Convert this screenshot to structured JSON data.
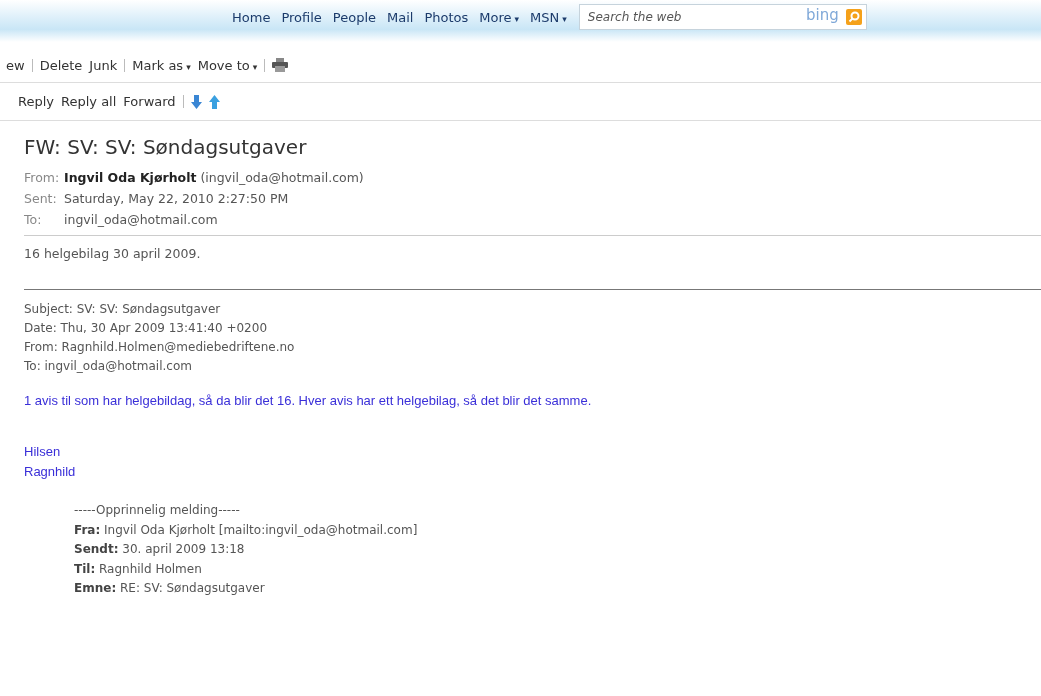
{
  "nav": {
    "links": [
      {
        "label": "Home"
      },
      {
        "label": "Profile"
      },
      {
        "label": "People"
      },
      {
        "label": "Mail"
      },
      {
        "label": "Photos"
      },
      {
        "label": "More",
        "caret": "▾"
      },
      {
        "label": "MSN",
        "caret": "▾"
      }
    ],
    "search": {
      "placeholder": "Search the web",
      "logo": "bing"
    }
  },
  "toolbar": [
    {
      "label": "ew",
      "sep": true
    },
    {
      "label": "Delete"
    },
    {
      "label": "Junk",
      "sep": true
    },
    {
      "label": "Mark as",
      "caret": "▾"
    },
    {
      "label": "Move to",
      "caret": "▾",
      "sep": true
    },
    {
      "kind": "print"
    }
  ],
  "actions": [
    {
      "label": "Reply"
    },
    {
      "label": "Reply all"
    },
    {
      "label": "Forward",
      "sep": true
    },
    {
      "kind": "down"
    },
    {
      "kind": "up"
    }
  ],
  "message": {
    "subject": "FW: SV: SV: Søndagsutgaver",
    "headers": [
      {
        "label": "From:",
        "value": "**Ingvil Oda Kjørholt** (ingvil_oda@hotmail.com)"
      },
      {
        "label": "Sent:",
        "value": "Saturday, May 22, 2010 2:27:50 PM"
      },
      {
        "label": "To:",
        "value": "ingvil_oda@hotmail.com"
      }
    ],
    "body": "16 helgebilag 30 april 2009.",
    "forwarded_headers": [
      "Subject: SV: SV: Søndagsutgaver",
      "Date: Thu, 30 Apr 2009 13:41:40 +0200",
      "From: Ragnhild.Holmen@mediebedriftene.no",
      "To: ingvil_oda@hotmail.com"
    ],
    "reply_text": "1 avis til som har helgebildag, så da blir det 16. Hver avis har ett helgebilag, så det blir det samme.",
    "signature": [
      "Hilsen",
      "Ragnhild"
    ],
    "original": [
      "-----Opprinnelig melding-----",
      "**Fra:** Ingvil Oda Kjørholt [mailto:ingvil_oda@hotmail.com]",
      "**Sendt:** 30. april 2009 13:18",
      "**Til:** Ragnhild Holmen",
      "**Emne:** RE: SV: Søndagsutgaver"
    ]
  }
}
